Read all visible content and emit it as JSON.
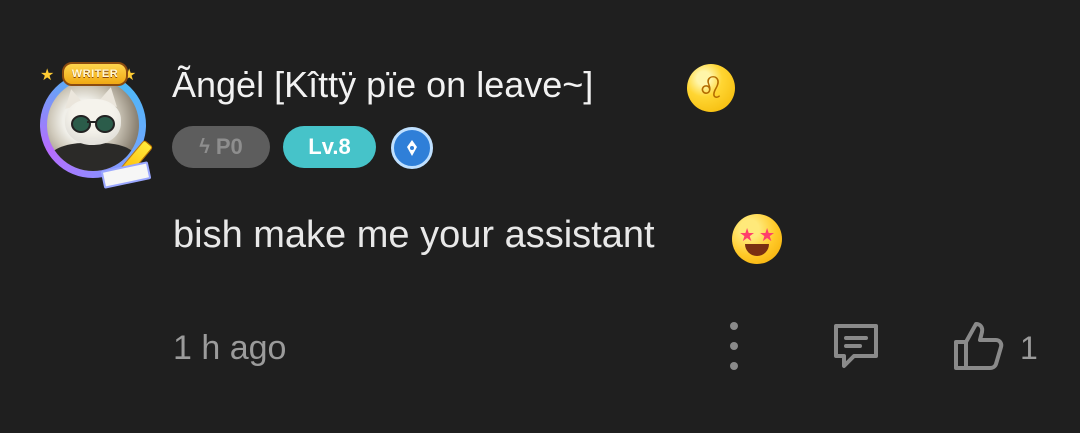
{
  "comment": {
    "user": {
      "display_name": "Ãngėl [Kîttÿ pïe on leave~]",
      "avatar_frame_label": "WRITER",
      "zodiac_symbol": "♌",
      "points_badge": "P0",
      "level_badge": "Lv.8",
      "verified_icon": "pen-nib-icon"
    },
    "text": "bish make me your assistant",
    "emoji": "star-struck",
    "timestamp": "1 h ago",
    "actions": {
      "more_icon": "more-vertical-icon",
      "reply_icon": "comment-icon",
      "like_icon": "thumbs-up-icon",
      "like_count": "1"
    }
  },
  "colors": {
    "background": "#1f1f1f",
    "level_badge": "#46c3c9",
    "points_badge": "#5d5d5d",
    "muted_text": "#9b9b9b"
  }
}
